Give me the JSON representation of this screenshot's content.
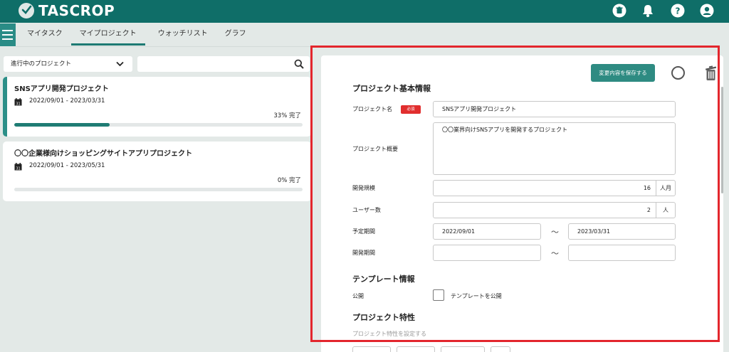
{
  "app": {
    "logo_text": "TASCROP"
  },
  "header": {
    "icons": [
      "trash-icon",
      "bell-icon",
      "help-icon",
      "user-icon"
    ]
  },
  "nav": {
    "tabs": [
      {
        "label": "マイタスク"
      },
      {
        "label": "マイプロジェクト",
        "active": true
      },
      {
        "label": "ウォッチリスト"
      },
      {
        "label": "グラフ"
      }
    ]
  },
  "filter": {
    "selected": "進行中のプロジェクト",
    "search_value": ""
  },
  "projects": [
    {
      "title": "SNSアプリ開発プロジェクト",
      "dates": "2022/09/01 - 2023/03/31",
      "progress_label": "33% 完了",
      "progress": 0.33
    },
    {
      "title": "〇〇企業様向けショッピングサイトアプリプロジェクト",
      "dates": "2022/09/01 - 2023/05/31",
      "progress_label": "0% 完了",
      "progress": 0.0
    }
  ],
  "form": {
    "save_label": "変更内容を保存する",
    "basic_section_title": "プロジェクト基本情報",
    "name_label": "プロジェクト名",
    "required_badge": "必須",
    "name_value": "SNSアプリ開発プロジェクト",
    "summary_label": "プロジェクト概要",
    "summary_value": "〇〇業界向けSNSアプリを開発するプロジェクト",
    "scale_label": "開発規模",
    "scale_value": "16",
    "scale_unit": "人月",
    "users_label": "ユーザー数",
    "users_value": "2",
    "users_unit": "人",
    "planned_label": "予定期間",
    "planned_start": "2022/09/01",
    "planned_end": "2023/03/31",
    "dev_period_label": "開発期間",
    "dev_start": "",
    "dev_end": "",
    "range_sep": "～",
    "template_section_title": "テンプレート情報",
    "public_label": "公開",
    "template_public_label": "テンプレートを公開",
    "traits_section_title": "プロジェクト特性",
    "traits_hint": "プロジェクト特性を設定する"
  },
  "colors": {
    "header": "#0f6e68",
    "accent": "#2e8b82",
    "required": "#e12e2e",
    "highlight_frame": "#e3262d"
  }
}
